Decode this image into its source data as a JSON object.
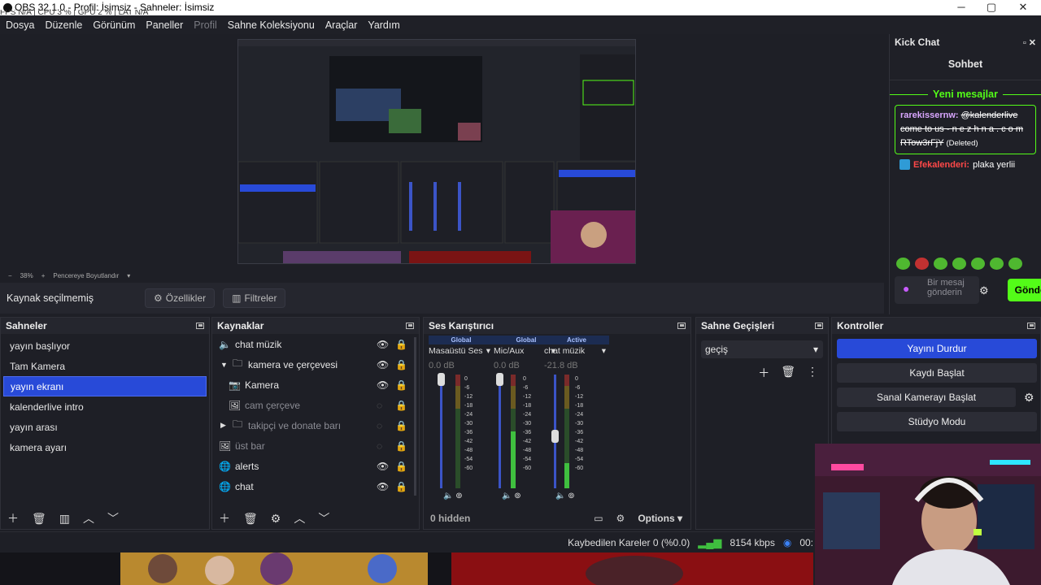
{
  "window": {
    "title": "OBS 32.1.0 - Profil: İsimsiz - Sahneler: İsimsiz",
    "stats_overlay": "FPS N/A | CPU 3 % | GPU 2 % | LAT N/A",
    "minimize": "─",
    "maximize": "▢",
    "close": "✕"
  },
  "menu": [
    "Dosya",
    "Düzenle",
    "Görünüm",
    "Paneller",
    "Profil",
    "Sahne Koleksiyonu",
    "Araçlar",
    "Yardım"
  ],
  "preview": {
    "zoom": "38%",
    "fit_label": "Pencereye Boyutlandır"
  },
  "source_toolbar": {
    "status": "Kaynak seçilmemiş",
    "properties": "Özellikler",
    "filters": "Filtreler"
  },
  "chat": {
    "title": "Kick Chat",
    "heading": "Sohbet",
    "new_messages": "Yeni mesajlar",
    "msg1_user": "rarekissernw:",
    "msg1_text": "@kalenderlive come to us - n e z h n a . c o m RTow3rFjY",
    "msg1_tag": "(Deleted)",
    "msg2_user": "Efekalenderi:",
    "msg2_text": "plaka yerlii",
    "input_placeholder": "Bir mesaj gönderin",
    "send": "Gönder"
  },
  "scenes": {
    "title": "Sahneler",
    "items": [
      "yayın başlıyor",
      "Tam Kamera",
      "yayın ekranı",
      "kalenderlive intro",
      "yayın arası",
      "kamera ayarı"
    ],
    "selected": 2
  },
  "sources": {
    "title": "Kaynaklar",
    "items": [
      {
        "name": "chat müzik",
        "icon": "speaker-icon",
        "indent": 0,
        "visible": true
      },
      {
        "name": "kamera ve çerçevesi",
        "icon": "folder-icon",
        "indent": 1,
        "visible": true,
        "expanded": true
      },
      {
        "name": "Kamera",
        "icon": "camera-icon",
        "indent": 2,
        "visible": true
      },
      {
        "name": "cam çerçeve",
        "icon": "image-icon",
        "indent": 2,
        "visible": false
      },
      {
        "name": "takipçi ve donate barı",
        "icon": "folder-icon",
        "indent": 1,
        "visible": false,
        "expanded": false
      },
      {
        "name": "üst bar",
        "icon": "image-icon",
        "indent": 0,
        "visible": false
      },
      {
        "name": "alerts",
        "icon": "globe-icon",
        "indent": 0,
        "visible": true
      },
      {
        "name": "chat",
        "icon": "globe-icon",
        "indent": 0,
        "visible": true
      }
    ]
  },
  "mixer": {
    "title": "Ses Karıştırıcı",
    "hidden_label": "0 hidden",
    "options": "Options",
    "channels": [
      {
        "tag": "Global",
        "name": "Masaüstü Ses",
        "db": "0.0 dB",
        "level": 0.0,
        "fader": 1.0
      },
      {
        "tag": "Global",
        "name": "Mic/Aux",
        "db": "0.0 dB",
        "level": 0.5,
        "fader": 1.0
      },
      {
        "tag": "Active",
        "name": "chat müzik",
        "db": "-21.8 dB",
        "level": 0.2,
        "fader": 0.5
      }
    ],
    "ticks": [
      "0",
      "-6",
      "-12",
      "-18",
      "-24",
      "-30",
      "-36",
      "-42",
      "-48",
      "-54",
      "-60"
    ]
  },
  "transitions": {
    "title": "Sahne Geçişleri",
    "selected": "geçiş"
  },
  "controls": {
    "title": "Kontroller",
    "buttons": [
      "Yayını Durdur",
      "Kaydı Başlat",
      "Sanal Kamerayı Başlat",
      "Stüdyo Modu"
    ]
  },
  "status": {
    "dropped": "Kaybedilen Kareler 0 (%0.0)",
    "bitrate": "8154 kbps",
    "time": "00:"
  },
  "colors": {
    "accent": "#284ad8",
    "kick_green": "#53fc18",
    "bg": "#1e1f26"
  }
}
